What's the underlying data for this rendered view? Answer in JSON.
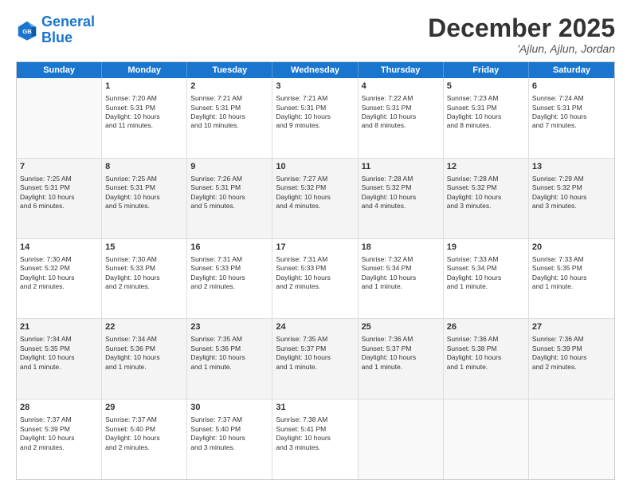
{
  "header": {
    "logo_general": "General",
    "logo_blue": "Blue",
    "title": "December 2025",
    "subtitle": "'Ajlun, Ajlun, Jordan"
  },
  "calendar": {
    "days": [
      "Sunday",
      "Monday",
      "Tuesday",
      "Wednesday",
      "Thursday",
      "Friday",
      "Saturday"
    ],
    "rows": [
      [
        {
          "num": "",
          "lines": []
        },
        {
          "num": "1",
          "lines": [
            "Sunrise: 7:20 AM",
            "Sunset: 5:31 PM",
            "Daylight: 10 hours",
            "and 11 minutes."
          ]
        },
        {
          "num": "2",
          "lines": [
            "Sunrise: 7:21 AM",
            "Sunset: 5:31 PM",
            "Daylight: 10 hours",
            "and 10 minutes."
          ]
        },
        {
          "num": "3",
          "lines": [
            "Sunrise: 7:21 AM",
            "Sunset: 5:31 PM",
            "Daylight: 10 hours",
            "and 9 minutes."
          ]
        },
        {
          "num": "4",
          "lines": [
            "Sunrise: 7:22 AM",
            "Sunset: 5:31 PM",
            "Daylight: 10 hours",
            "and 8 minutes."
          ]
        },
        {
          "num": "5",
          "lines": [
            "Sunrise: 7:23 AM",
            "Sunset: 5:31 PM",
            "Daylight: 10 hours",
            "and 8 minutes."
          ]
        },
        {
          "num": "6",
          "lines": [
            "Sunrise: 7:24 AM",
            "Sunset: 5:31 PM",
            "Daylight: 10 hours",
            "and 7 minutes."
          ]
        }
      ],
      [
        {
          "num": "7",
          "lines": [
            "Sunrise: 7:25 AM",
            "Sunset: 5:31 PM",
            "Daylight: 10 hours",
            "and 6 minutes."
          ]
        },
        {
          "num": "8",
          "lines": [
            "Sunrise: 7:25 AM",
            "Sunset: 5:31 PM",
            "Daylight: 10 hours",
            "and 5 minutes."
          ]
        },
        {
          "num": "9",
          "lines": [
            "Sunrise: 7:26 AM",
            "Sunset: 5:31 PM",
            "Daylight: 10 hours",
            "and 5 minutes."
          ]
        },
        {
          "num": "10",
          "lines": [
            "Sunrise: 7:27 AM",
            "Sunset: 5:32 PM",
            "Daylight: 10 hours",
            "and 4 minutes."
          ]
        },
        {
          "num": "11",
          "lines": [
            "Sunrise: 7:28 AM",
            "Sunset: 5:32 PM",
            "Daylight: 10 hours",
            "and 4 minutes."
          ]
        },
        {
          "num": "12",
          "lines": [
            "Sunrise: 7:28 AM",
            "Sunset: 5:32 PM",
            "Daylight: 10 hours",
            "and 3 minutes."
          ]
        },
        {
          "num": "13",
          "lines": [
            "Sunrise: 7:29 AM",
            "Sunset: 5:32 PM",
            "Daylight: 10 hours",
            "and 3 minutes."
          ]
        }
      ],
      [
        {
          "num": "14",
          "lines": [
            "Sunrise: 7:30 AM",
            "Sunset: 5:32 PM",
            "Daylight: 10 hours",
            "and 2 minutes."
          ]
        },
        {
          "num": "15",
          "lines": [
            "Sunrise: 7:30 AM",
            "Sunset: 5:33 PM",
            "Daylight: 10 hours",
            "and 2 minutes."
          ]
        },
        {
          "num": "16",
          "lines": [
            "Sunrise: 7:31 AM",
            "Sunset: 5:33 PM",
            "Daylight: 10 hours",
            "and 2 minutes."
          ]
        },
        {
          "num": "17",
          "lines": [
            "Sunrise: 7:31 AM",
            "Sunset: 5:33 PM",
            "Daylight: 10 hours",
            "and 2 minutes."
          ]
        },
        {
          "num": "18",
          "lines": [
            "Sunrise: 7:32 AM",
            "Sunset: 5:34 PM",
            "Daylight: 10 hours",
            "and 1 minute."
          ]
        },
        {
          "num": "19",
          "lines": [
            "Sunrise: 7:33 AM",
            "Sunset: 5:34 PM",
            "Daylight: 10 hours",
            "and 1 minute."
          ]
        },
        {
          "num": "20",
          "lines": [
            "Sunrise: 7:33 AM",
            "Sunset: 5:35 PM",
            "Daylight: 10 hours",
            "and 1 minute."
          ]
        }
      ],
      [
        {
          "num": "21",
          "lines": [
            "Sunrise: 7:34 AM",
            "Sunset: 5:35 PM",
            "Daylight: 10 hours",
            "and 1 minute."
          ]
        },
        {
          "num": "22",
          "lines": [
            "Sunrise: 7:34 AM",
            "Sunset: 5:36 PM",
            "Daylight: 10 hours",
            "and 1 minute."
          ]
        },
        {
          "num": "23",
          "lines": [
            "Sunrise: 7:35 AM",
            "Sunset: 5:36 PM",
            "Daylight: 10 hours",
            "and 1 minute."
          ]
        },
        {
          "num": "24",
          "lines": [
            "Sunrise: 7:35 AM",
            "Sunset: 5:37 PM",
            "Daylight: 10 hours",
            "and 1 minute."
          ]
        },
        {
          "num": "25",
          "lines": [
            "Sunrise: 7:36 AM",
            "Sunset: 5:37 PM",
            "Daylight: 10 hours",
            "and 1 minute."
          ]
        },
        {
          "num": "26",
          "lines": [
            "Sunrise: 7:36 AM",
            "Sunset: 5:38 PM",
            "Daylight: 10 hours",
            "and 1 minute."
          ]
        },
        {
          "num": "27",
          "lines": [
            "Sunrise: 7:36 AM",
            "Sunset: 5:39 PM",
            "Daylight: 10 hours",
            "and 2 minutes."
          ]
        }
      ],
      [
        {
          "num": "28",
          "lines": [
            "Sunrise: 7:37 AM",
            "Sunset: 5:39 PM",
            "Daylight: 10 hours",
            "and 2 minutes."
          ]
        },
        {
          "num": "29",
          "lines": [
            "Sunrise: 7:37 AM",
            "Sunset: 5:40 PM",
            "Daylight: 10 hours",
            "and 2 minutes."
          ]
        },
        {
          "num": "30",
          "lines": [
            "Sunrise: 7:37 AM",
            "Sunset: 5:40 PM",
            "Daylight: 10 hours",
            "and 3 minutes."
          ]
        },
        {
          "num": "31",
          "lines": [
            "Sunrise: 7:38 AM",
            "Sunset: 5:41 PM",
            "Daylight: 10 hours",
            "and 3 minutes."
          ]
        },
        {
          "num": "",
          "lines": []
        },
        {
          "num": "",
          "lines": []
        },
        {
          "num": "",
          "lines": []
        }
      ]
    ]
  }
}
